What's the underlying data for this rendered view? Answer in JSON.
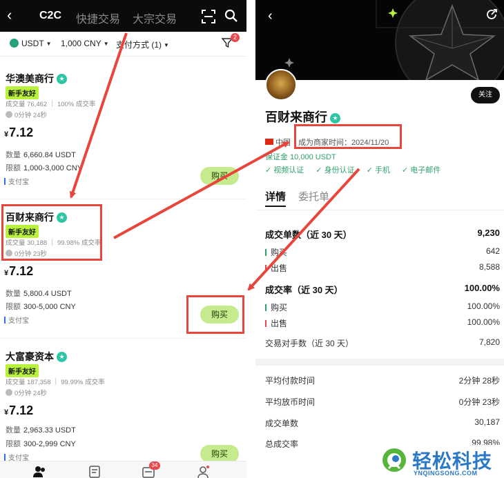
{
  "left": {
    "topbar": {
      "tabs": [
        "C2C",
        "快捷交易",
        "大宗交易"
      ]
    },
    "filters": {
      "coin": "USDT",
      "amount": "1,000 CNY",
      "payment": "支付方式 (1)",
      "filter_badge": "2"
    },
    "merchants": [
      {
        "name": "华澳美商行",
        "tag": "新手友好",
        "stats": "成交量 76,462 ｜ 100% 成交率",
        "time": "0分钟 24秒",
        "currency": "¥",
        "price": "7.12",
        "qty_label": "数量",
        "qty": "6,660.84 USDT",
        "limit_label": "限额",
        "limit": "1,000-3,000 CNY",
        "payment": "支付宝",
        "buy": "购买"
      },
      {
        "name": "百财来商行",
        "tag": "新手友好",
        "stats": "成交量 30,188 ｜ 99.98% 成交率",
        "time": "0分钟 23秒",
        "currency": "¥",
        "price": "7.12",
        "qty_label": "数量",
        "qty": "5,800.4 USDT",
        "limit_label": "限额",
        "limit": "300-5,000 CNY",
        "payment": "支付宝",
        "buy": "购买"
      },
      {
        "name": "大富豪资本",
        "tag": "新手友好",
        "stats": "成交量 187,358 ｜ 99.99% 成交率",
        "time": "0分钟 24秒",
        "currency": "¥",
        "price": "7.12",
        "qty_label": "数量",
        "qty": "2,963.33 USDT",
        "limit_label": "限额",
        "limit": "300-2,999 CNY",
        "payment": "支付宝",
        "buy": "购买"
      }
    ],
    "bottom_nav": {
      "orders_badge": "34"
    }
  },
  "right": {
    "follow": "关注",
    "name": "百财来商行",
    "country": "中国",
    "merchant_since": "成为商家时间：2024/11/20",
    "deposit": "保证金 10,000 USDT",
    "verifications": [
      "✓ 视频认证",
      "✓ 身份认证",
      "✓ 手机",
      "✓ 电子邮件"
    ],
    "tabs": [
      "详情",
      "委托单"
    ],
    "stats": [
      {
        "label": "成交单数（近 30 天）",
        "value": "9,230"
      },
      {
        "label": "购买",
        "value": "642"
      },
      {
        "label": "出售",
        "value": "8,588"
      },
      {
        "label": "成交率（近 30 天）",
        "value": "100.00%"
      },
      {
        "label": "购买",
        "value": "100.00%"
      },
      {
        "label": "出售",
        "value": "100.00%"
      },
      {
        "label": "交易对手数（近 30 天）",
        "value": "7,820"
      },
      {
        "label": "平均付款时间",
        "value": "2分钟 28秒"
      },
      {
        "label": "平均放币时间",
        "value": "0分钟 23秒"
      },
      {
        "label": "成交单数",
        "value": "30,187"
      },
      {
        "label": "总成交率",
        "value": "99.98%"
      }
    ]
  },
  "watermark": {
    "cn": "轻松科技",
    "en": "YNQINGSONG.COM"
  },
  "colors": {
    "annotation_red": "#e8453c",
    "buy_green": "#c6ea8e",
    "tag_lime": "#b9f23d",
    "verified_teal": "#2ec4a6",
    "text_green": "#2ea36b"
  }
}
